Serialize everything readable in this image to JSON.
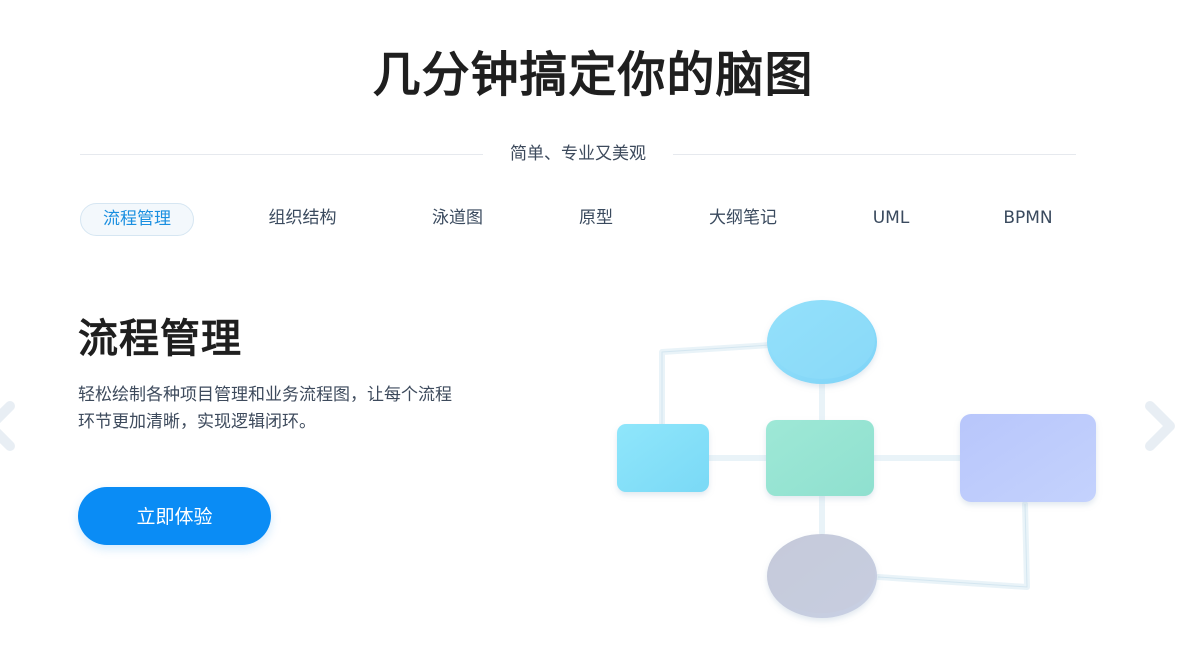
{
  "hero": {
    "title": "几分钟搞定你的脑图",
    "subtitle": "简单、专业又美观"
  },
  "tabs": [
    {
      "label": "流程管理",
      "active": true
    },
    {
      "label": "组织结构",
      "active": false
    },
    {
      "label": "泳道图",
      "active": false
    },
    {
      "label": "原型",
      "active": false
    },
    {
      "label": "大纲笔记",
      "active": false
    },
    {
      "label": "UML",
      "active": false
    },
    {
      "label": "BPMN",
      "active": false
    }
  ],
  "feature": {
    "heading": "流程管理",
    "description": "轻松绘制各种项目管理和业务流程图，让每个流程环节更加清晰，实现逻辑闭环。",
    "cta_label": "立即体验"
  },
  "navigation": {
    "prev_icon": "chevron-left-icon",
    "next_icon": "chevron-right-icon"
  },
  "colors": {
    "accent": "#0a8cf5",
    "active_tab_text": "#1a8fe0",
    "heading": "#1f1f1f",
    "body_text": "#3d4a5c"
  }
}
